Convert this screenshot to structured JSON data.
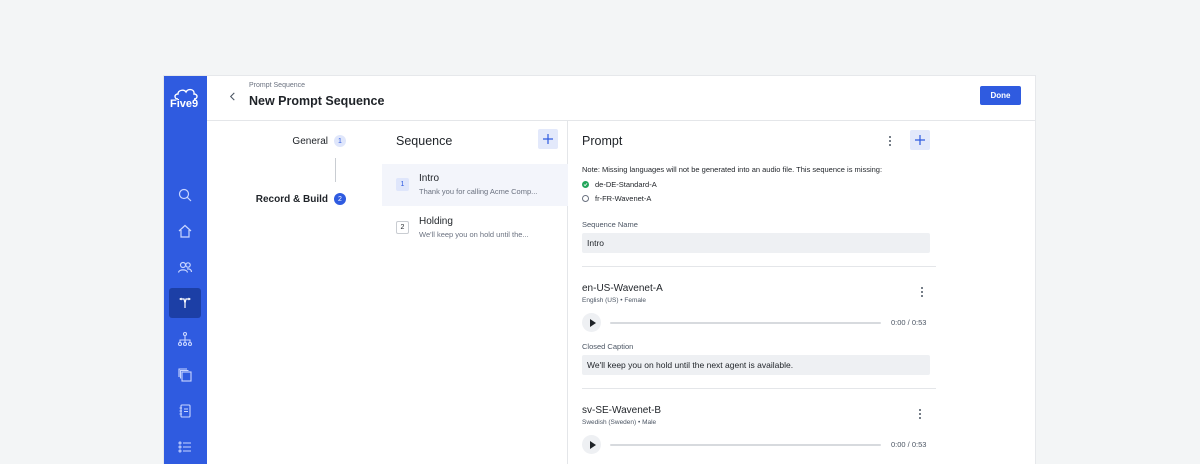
{
  "sidebar": {
    "logo_text": "Five9",
    "items": [
      {
        "icon": "search-icon"
      },
      {
        "icon": "home-icon"
      },
      {
        "icon": "users-icon"
      },
      {
        "icon": "routing-icon",
        "active": true
      },
      {
        "icon": "hierarchy-icon"
      },
      {
        "icon": "copy-icon"
      },
      {
        "icon": "notebook-icon"
      },
      {
        "icon": "list-icon"
      }
    ]
  },
  "header": {
    "breadcrumb": "Prompt Sequence",
    "title": "New Prompt Sequence",
    "done_label": "Done"
  },
  "steps": [
    {
      "label": "General",
      "number": "1"
    },
    {
      "label": "Record & Build",
      "number": "2"
    }
  ],
  "sequence": {
    "title": "Sequence",
    "items": [
      {
        "index": "1",
        "name": "Intro",
        "subtitle": "Thank you for calling Acme Comp..."
      },
      {
        "index": "2",
        "name": "Holding",
        "subtitle": "We'll keep you on hold until the..."
      }
    ]
  },
  "prompt": {
    "title": "Prompt",
    "note": "Note: Missing languages will not be generated into an audio file. This sequence is missing:",
    "missing_languages": [
      {
        "name": "de-DE-Standard-A",
        "status": "done"
      },
      {
        "name": "fr-FR-Wavenet-A",
        "status": "pending"
      }
    ],
    "sequence_name_label": "Sequence Name",
    "sequence_name_value": "Intro",
    "voices": [
      {
        "name": "en-US-Wavenet-A",
        "meta": "English (US) • Female",
        "time": "0:00 / 0:53",
        "progress": 0,
        "caption_label": "Closed Caption",
        "caption": "We'll keep you on hold until the next agent is available."
      },
      {
        "name": "sv-SE-Wavenet-B",
        "meta": "Swedish (Sweden) • Male",
        "time": "0:00 / 0:53",
        "progress": 0
      }
    ]
  },
  "colors": {
    "brand": "#2f5be0",
    "sidebar_active": "#1c3fa6",
    "success": "#22a55a"
  }
}
